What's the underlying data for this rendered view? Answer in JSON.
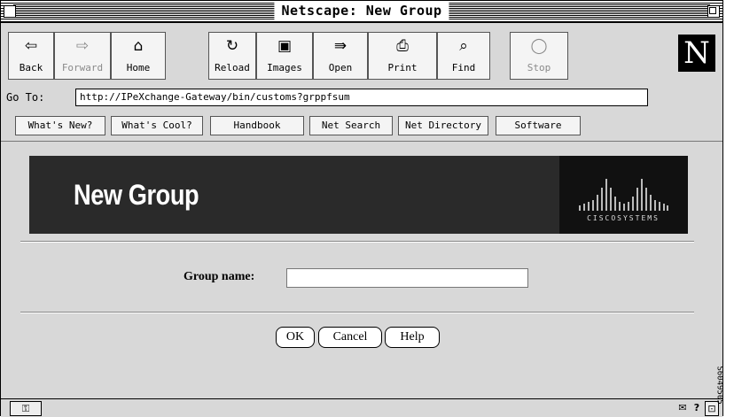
{
  "window": {
    "title": "Netscape: New Group"
  },
  "toolbar": {
    "buttons": [
      {
        "label": "Back",
        "icon": "back-arrow-icon",
        "glyph": "⇦",
        "enabled": true
      },
      {
        "label": "Forward",
        "icon": "forward-arrow-icon",
        "glyph": "⇨",
        "enabled": false
      },
      {
        "label": "Home",
        "icon": "home-icon",
        "glyph": "⌂",
        "enabled": true
      },
      {
        "label": "Reload",
        "icon": "reload-icon",
        "glyph": "↻",
        "enabled": true
      },
      {
        "label": "Images",
        "icon": "images-icon",
        "glyph": "▣",
        "enabled": true
      },
      {
        "label": "Open",
        "icon": "open-icon",
        "glyph": "⇛",
        "enabled": true
      },
      {
        "label": "Print",
        "icon": "print-icon",
        "glyph": "⎙",
        "enabled": true
      },
      {
        "label": "Find",
        "icon": "find-icon",
        "glyph": "⌕",
        "enabled": true
      },
      {
        "label": "Stop",
        "icon": "stop-icon",
        "glyph": "◯",
        "enabled": false
      }
    ],
    "logo": "N"
  },
  "location": {
    "label": "Go To:",
    "url": "http://IPeXchange-Gateway/bin/customs?grppfsum"
  },
  "directory": [
    "What's New?",
    "What's Cool?",
    "Handbook",
    "Net Search",
    "Net Directory",
    "Software"
  ],
  "page": {
    "heading": "New Group",
    "logo_text": "CISCOSYSTEMS",
    "form": {
      "group_name_label": "Group name:",
      "group_name_value": ""
    },
    "buttons": {
      "ok": "OK",
      "cancel": "Cancel",
      "help": "Help"
    }
  },
  "side_text": "S6049505"
}
